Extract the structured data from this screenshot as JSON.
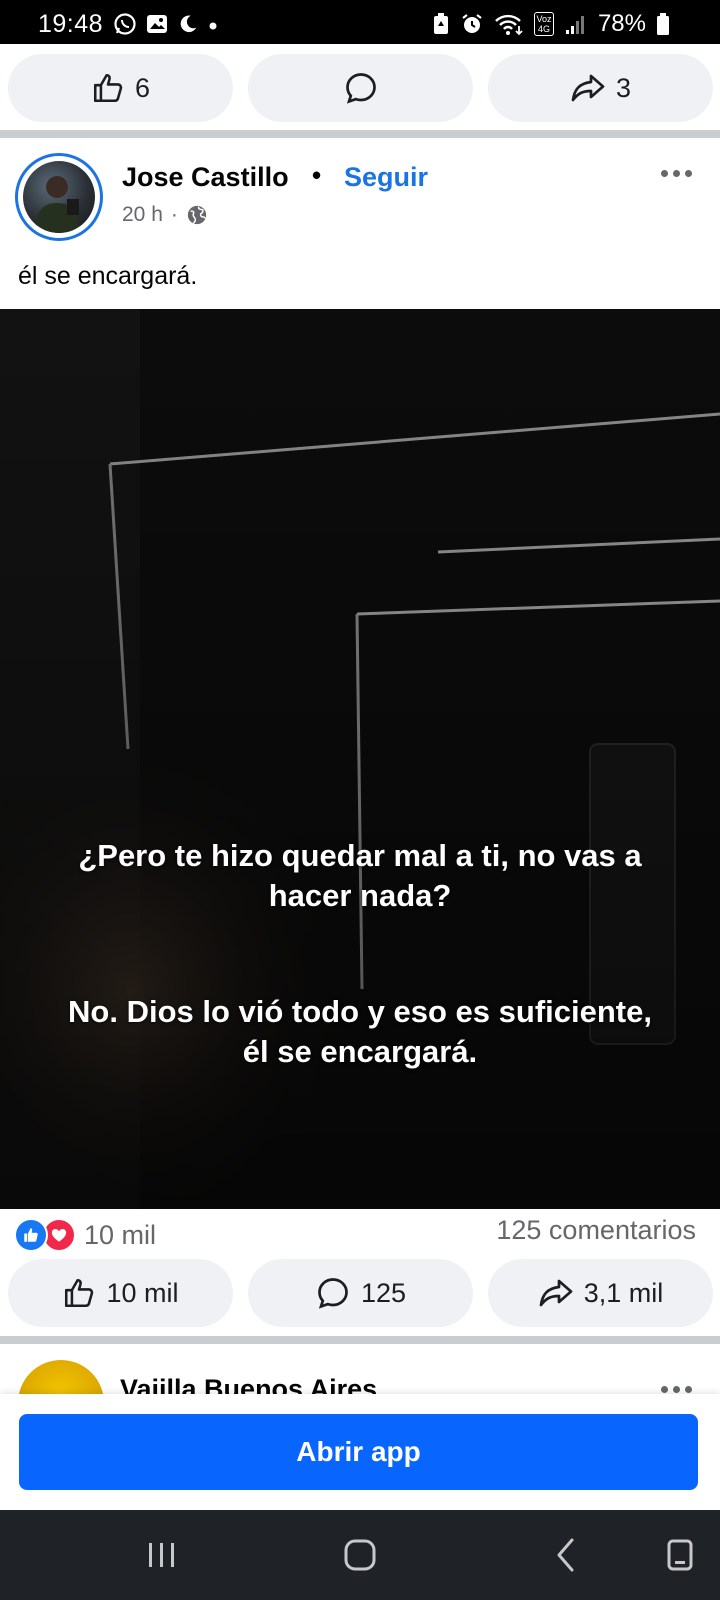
{
  "status_bar": {
    "time": "19:48",
    "left_icons": [
      "whatsapp-icon",
      "gallery-icon",
      "moon-icon",
      "dot-icon"
    ],
    "right_icons": [
      "battery-saver-icon",
      "alarm-icon",
      "wifi-icon",
      "volte-4g-icon",
      "signal-icon"
    ],
    "network_top": "Voz",
    "network_bottom": "4G",
    "battery_percent": "78%"
  },
  "prev_post_actions": {
    "like_count": "6",
    "comment_count": "",
    "share_count": "3"
  },
  "post": {
    "author": "Jose Castillo",
    "separator": "•",
    "follow_label": "Seguir",
    "time": "20 h",
    "time_separator": "·",
    "privacy_icon": "globe-icon",
    "caption": "él se encargará.",
    "video_subtitle_1": "¿Pero te hizo quedar mal a ti, no vas a hacer nada?",
    "video_subtitle_2": "No. Dios lo vió todo y eso es suficiente, él se encargará.",
    "reactions": [
      "like-icon",
      "love-icon"
    ],
    "reaction_count": "10 mil",
    "comments_summary": "125 comentarios",
    "like_count": "10 mil",
    "comment_count": "125",
    "share_count": "3,1 mil"
  },
  "next_post": {
    "author": "Vajilla Buenos Aires"
  },
  "open_app_button": "Abrir app",
  "nav_bar": {
    "items": [
      "recents-icon",
      "home-icon",
      "back-icon",
      "keyboard-icon"
    ]
  },
  "colors": {
    "brand_blue": "#1b74e4",
    "button_blue": "#0866ff",
    "pill_bg": "#eff1f5",
    "secondary_text": "#65676b"
  }
}
